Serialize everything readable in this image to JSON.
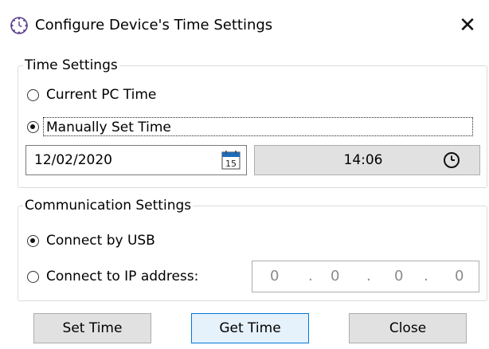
{
  "window": {
    "title": "Configure Device's Time Settings",
    "close_glyph": "✕",
    "icon": "clock-settings-icon"
  },
  "time_settings": {
    "legend": "Time Settings",
    "options": [
      {
        "label": "Current PC Time",
        "checked": false
      },
      {
        "label": "Manually Set Time",
        "checked": true
      }
    ],
    "date_value": "12/02/2020",
    "calendar_day": "15",
    "time_value": "14:06"
  },
  "communication_settings": {
    "legend": "Communication Settings",
    "options": [
      {
        "label": "Connect by USB",
        "checked": true
      },
      {
        "label": "Connect to IP address:",
        "checked": false
      }
    ],
    "ip_parts": [
      "0",
      "0",
      "0",
      "0"
    ],
    "ip_separator": "."
  },
  "buttons": {
    "set_time": "Set Time",
    "get_time": "Get Time",
    "close": "Close"
  },
  "colors": {
    "default_button_border": "#0078d7",
    "default_button_fill": "#e5f1fb",
    "button_fill": "#e1e1e1",
    "calendar_accent": "#1e6bb8"
  }
}
